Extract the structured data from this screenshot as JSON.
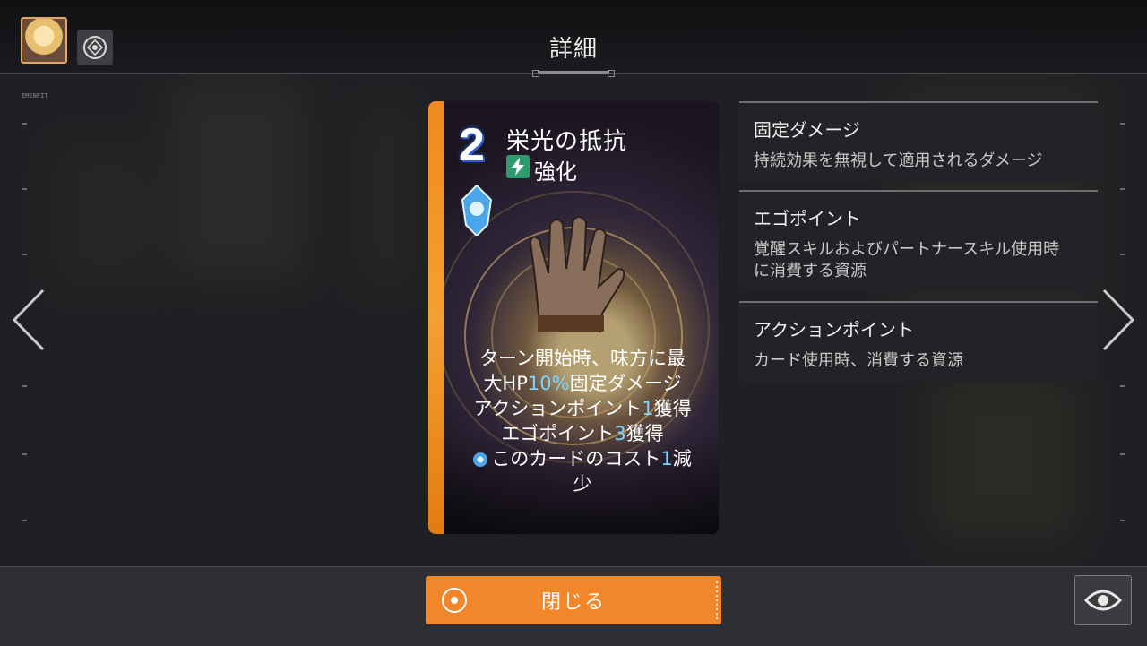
{
  "header": {
    "title": "詳細",
    "small_label": "EMENFIT"
  },
  "card": {
    "cost": "2",
    "name": "栄光の抵抗",
    "type": "強化",
    "type_icon": "lightning-icon",
    "ego_icon": "blue-gem-icon",
    "description": {
      "line1": "ターン開始時、味方に最",
      "line2_pre": "大HP",
      "line2_hl": "10%",
      "line2_post": "固定ダメージ",
      "line3_pre": "アクションポイント",
      "line3_hl": "1",
      "line3_post": "獲得",
      "line4_pre": "エゴポイント",
      "line4_hl": "3",
      "line4_post": "獲得",
      "line5_pre": "このカードのコスト",
      "line5_hl": "1",
      "line5_post": "減",
      "line6": "少"
    },
    "colors": {
      "frame_accent": "#f08a1c",
      "highlight": "#7fd3ff"
    }
  },
  "glossary": [
    {
      "title": "固定ダメージ",
      "desc": "持続効果を無視して適用されるダメージ"
    },
    {
      "title": "エゴポイント",
      "desc_line1": "覚醒スキルおよびパートナースキル使用時",
      "desc_line2": "に消費する資源"
    },
    {
      "title": "アクションポイント",
      "desc": "カード使用時、消費する資源"
    }
  ],
  "bottom": {
    "close_label": "閉じる",
    "close_color": "#f1862a"
  }
}
